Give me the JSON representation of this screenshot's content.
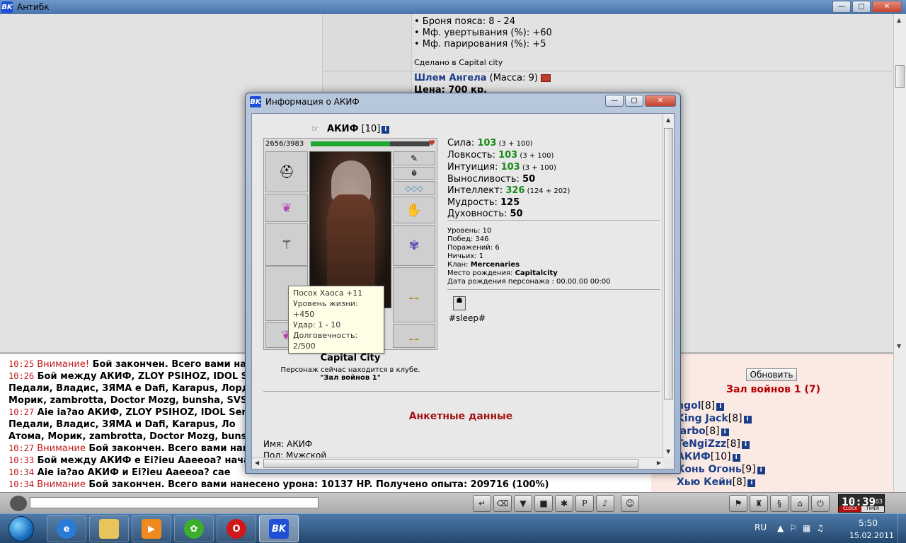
{
  "main": {
    "title": "Антибк",
    "controls": {
      "min": "—",
      "max": "▢",
      "close": "✕"
    },
    "item_lines": [
      "• Броня пояса: 8 - 24",
      "• Мф. увертывания (%): +60",
      "• Мф. парирования (%): +5"
    ],
    "made_in": "Сделано в Capital city",
    "helm_name": "Шлем Ангела",
    "helm_mass": " (Масса: 9)",
    "price": "Цена: 700 кр."
  },
  "chat": {
    "messages": [
      {
        "time": "10:25",
        "warn": " Внимание!",
        "text": " Бой закончен. Всего вами нане"
      },
      {
        "time": "10:26",
        "warn": "",
        "text": " Бой между АКИФ, ZLOY PSIHOZ, IDOL Se"
      },
      {
        "time": "",
        "warn": "",
        "text": "Педали, Владис, ЗЯМА е Dafi, Karapus, Лорд"
      },
      {
        "time": "",
        "warn": "",
        "text": "Морик, zambrotta, Doctor Mozg, bunsha, SVS"
      },
      {
        "time": "10:27",
        "warn": "",
        "text": " Aie ia?ao АКИФ, ZLOY PSIHOZ, IDOL Ser"
      },
      {
        "time": "",
        "warn": "",
        "text": "Педали, Владис, ЗЯМА и Dafi, Karapus, Ло"
      },
      {
        "time": "",
        "warn": "",
        "text": "Атома, Морик, zambrotta, Doctor Mozg, buns"
      },
      {
        "time": "10:27",
        "warn": " Внимание",
        "text": " Бой закончен. Всего вами нанес"
      },
      {
        "time": "10:33",
        "warn": "",
        "text": " Бой между АКИФ е Ei?ieu Aaeeoa? начал"
      },
      {
        "time": "10:34",
        "warn": "",
        "text": " Aie ia?ao АКИФ и Ei?ieu Aaeeoa? сае"
      },
      {
        "time": "10:34",
        "warn": " Внимание",
        "text": " Бой закончен. Всего вами нанесено урона: 10137 HP. Получено опыта: 209716 (100%)"
      }
    ]
  },
  "online": {
    "refresh": "Обновить",
    "room": "Зал войнов 1 (7)",
    "users": [
      {
        "name": "ngol",
        "level": "[8]"
      },
      {
        "name": "King Jack",
        "level": "[8]"
      },
      {
        "name": "larbo",
        "level": "[8]"
      },
      {
        "name": "TeNgiZzz",
        "level": "[8]"
      },
      {
        "name": "АКИФ",
        "level": "[10]"
      },
      {
        "name": "Конь Огонь",
        "level": "[9]"
      },
      {
        "name": "Хью Кейн",
        "level": "[8]"
      }
    ]
  },
  "toolbar": {
    "clock_time": "10:39",
    "clock_sec": "03",
    "clock_label": "CLOCK",
    "timer_label": "TIMER"
  },
  "taskbar": {
    "lang": "RU",
    "time": "5:50",
    "date": "15.02.2011"
  },
  "dialog": {
    "title": "Информация о АКИФ",
    "char_name": "АКИФ",
    "char_level": " [10]",
    "hp": "2656/3983",
    "hp_fraction": 0.667,
    "tooltip": [
      "Посох Хаоса +11",
      "Уровень жизни: +450",
      "Удар: 1 - 10",
      "Долговечность: 2/500"
    ],
    "stats": [
      {
        "label": "Сила: ",
        "value": "103",
        "extra": " (3 + 100)",
        "green": true
      },
      {
        "label": "Ловкость: ",
        "value": "103",
        "extra": " (3 + 100)",
        "green": true
      },
      {
        "label": "Интуиция: ",
        "value": "103",
        "extra": " (3 + 100)",
        "green": true
      },
      {
        "label": "Выносливость: ",
        "value": "50",
        "extra": "",
        "green": false
      },
      {
        "label": "Интеллект: ",
        "value": "326",
        "extra": " (124 + 202)",
        "green": true
      },
      {
        "label": "Мудрость: ",
        "value": "125",
        "extra": "",
        "green": false
      },
      {
        "label": "Духовность: ",
        "value": "50",
        "extra": "",
        "green": false
      }
    ],
    "meta": [
      {
        "label": "Уровень: ",
        "value": "10",
        "bold": false
      },
      {
        "label": "Побед: ",
        "value": "346",
        "bold": false
      },
      {
        "label": "Поражений: ",
        "value": "6",
        "bold": false
      },
      {
        "label": "Ничьих: ",
        "value": "1",
        "bold": false
      },
      {
        "label": "Клан: ",
        "value": "Mercenaries",
        "bold": true
      },
      {
        "label": "Место рождения: ",
        "value": "Capitalcity",
        "bold": true
      },
      {
        "label": "Дата рождения персонажа : ",
        "value": "00.00.00 00:00",
        "bold": false
      }
    ],
    "status": "#sleep#",
    "city": "Capital City",
    "location_text": "Персонаж сейчас находится в клубе.",
    "location_room": "\"Зал войнов 1\"",
    "profile_header": "Анкетные данные",
    "profile_name": "Имя: АКИФ",
    "profile_sex": "Пол: Мужской"
  }
}
